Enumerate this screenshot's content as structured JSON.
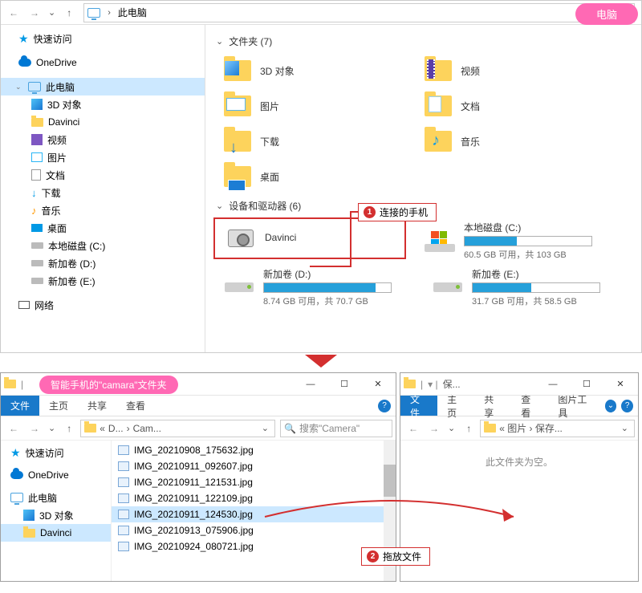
{
  "top": {
    "path": "此电脑",
    "pill": "电脑",
    "sidebar": {
      "quick": "快速访问",
      "onedrive": "OneDrive",
      "thispc": "此电脑",
      "items": [
        "3D 对象",
        "Davinci",
        "视频",
        "图片",
        "文档",
        "下载",
        "音乐",
        "桌面",
        "本地磁盘 (C:)",
        "新加卷 (D:)",
        "新加卷 (E:)"
      ],
      "network": "网络"
    },
    "section_folders": "文件夹 (7)",
    "folders": [
      "3D 对象",
      "图片",
      "下载",
      "桌面",
      "视频",
      "文档",
      "音乐"
    ],
    "section_drives": "设备和驱动器 (6)",
    "callout1": "连接的手机",
    "drives": {
      "davinci": "Davinci",
      "c": {
        "name": "本地磁盘 (C:)",
        "txt": "60.5 GB 可用，共 103 GB",
        "pct": 41
      },
      "d": {
        "name": "新加卷 (D:)",
        "txt": "8.74 GB 可用，共 70.7 GB",
        "pct": 88
      },
      "e": {
        "name": "新加卷 (E:)",
        "txt": "31.7 GB 可用，共 58.5 GB",
        "pct": 46
      }
    }
  },
  "left": {
    "pill": "智能手机的\"camara\"文件夹",
    "tabs": {
      "file": "文件",
      "home": "主页",
      "share": "共享",
      "view": "查看"
    },
    "crumb1": "D...",
    "crumb2": "Cam...",
    "search_ph": "搜索\"Camera\"",
    "sidebar": {
      "quick": "快速访问",
      "onedrive": "OneDrive",
      "thispc": "此电脑",
      "sub": [
        "3D 对象",
        "Davinci"
      ]
    },
    "files": [
      "IMG_20210908_175632.jpg",
      "IMG_20210911_092607.jpg",
      "IMG_20210911_121531.jpg",
      "IMG_20210911_122109.jpg",
      "IMG_20210911_124530.jpg",
      "IMG_20210913_075906.jpg",
      "IMG_20210924_080721.jpg"
    ]
  },
  "right": {
    "title_hint": "保...",
    "tabs": {
      "file": "文件",
      "home": "主页",
      "share": "共享",
      "view": "查看",
      "pic": "图片工具"
    },
    "crumb": "« 图片 › 保存...",
    "empty": "此文件夹为空。"
  },
  "callout2": "拖放文件"
}
